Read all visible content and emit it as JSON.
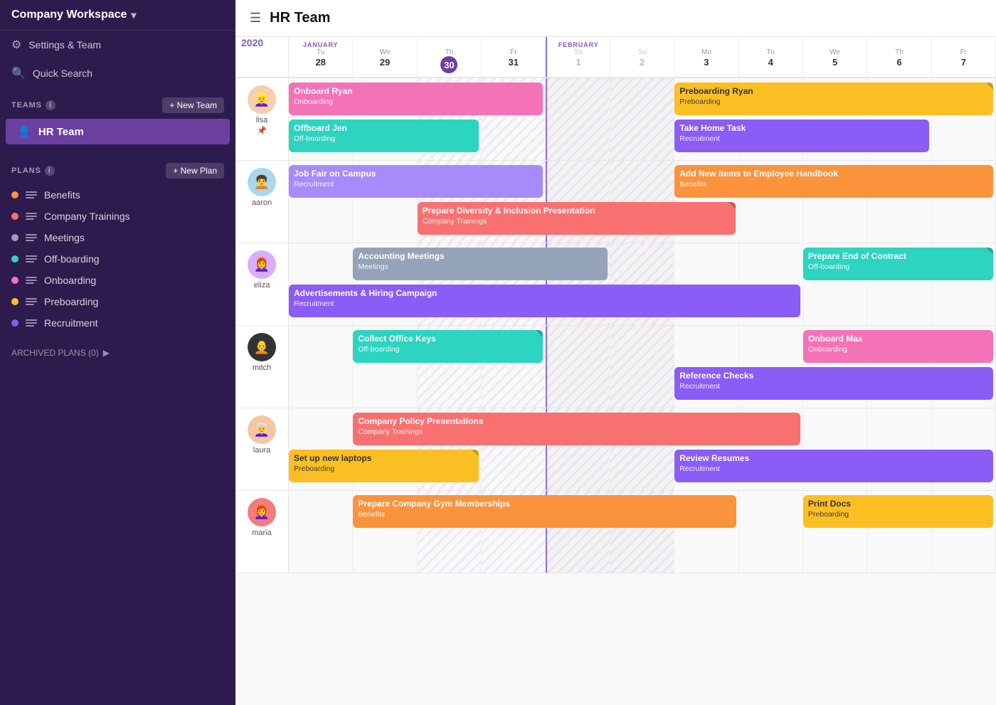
{
  "sidebar": {
    "workspace_name": "Company Workspace",
    "nav": [
      {
        "id": "settings",
        "label": "Settings & Team",
        "icon": "⚙"
      },
      {
        "id": "search",
        "label": "Quick Search",
        "icon": "🔍"
      }
    ],
    "teams_section": "TEAMS",
    "new_team_label": "+ New Team",
    "active_team": "HR Team",
    "plans_section": "PLANS",
    "new_plan_label": "+ New Plan",
    "plans": [
      {
        "id": "benefits",
        "label": "Benefits",
        "color": "#fb923c"
      },
      {
        "id": "company-trainings",
        "label": "Company Trainings",
        "color": "#f87171"
      },
      {
        "id": "meetings",
        "label": "Meetings",
        "color": "#94a3b8"
      },
      {
        "id": "off-boarding",
        "label": "Off-boarding",
        "color": "#2dd4bf"
      },
      {
        "id": "onboarding",
        "label": "Onboarding",
        "color": "#f472b6"
      },
      {
        "id": "preboarding",
        "label": "Preboarding",
        "color": "#fbbf24"
      },
      {
        "id": "recruitment",
        "label": "Recruitment",
        "color": "#8b5cf6"
      }
    ],
    "archived_label": "ARCHIVED PLANS (0)"
  },
  "header": {
    "title": "HR Team"
  },
  "calendar": {
    "year": "2020",
    "days": [
      {
        "name": "Tu",
        "num": "28",
        "month": "JANUARY",
        "weekend": false,
        "today": false,
        "hatched": false
      },
      {
        "name": "We",
        "num": "29",
        "month": "",
        "weekend": false,
        "today": false,
        "hatched": false
      },
      {
        "name": "Th",
        "num": "30",
        "month": "",
        "weekend": false,
        "today": true,
        "hatched": true
      },
      {
        "name": "Fr",
        "num": "31",
        "month": "",
        "weekend": false,
        "today": false,
        "hatched": true
      },
      {
        "name": "Sa",
        "num": "1",
        "month": "FEBRUARY",
        "weekend": true,
        "today": false,
        "hatched": true,
        "feb": true
      },
      {
        "name": "Su",
        "num": "2",
        "month": "",
        "weekend": true,
        "today": false,
        "hatched": true
      },
      {
        "name": "Mo",
        "num": "3",
        "month": "",
        "weekend": false,
        "today": false,
        "hatched": false
      },
      {
        "name": "Tu",
        "num": "4",
        "month": "",
        "weekend": false,
        "today": false,
        "hatched": false
      },
      {
        "name": "We",
        "num": "5",
        "month": "",
        "weekend": false,
        "today": false,
        "hatched": false
      },
      {
        "name": "Th",
        "num": "6",
        "month": "",
        "weekend": false,
        "today": false,
        "hatched": false
      },
      {
        "name": "Fr",
        "num": "7",
        "month": "",
        "weekend": false,
        "today": false,
        "hatched": false
      }
    ],
    "rows": [
      {
        "person": {
          "name": "lisa",
          "avatar_color": "#f5d0a9",
          "avatar_emoji": "👩",
          "pin": true
        },
        "tasks": [
          {
            "name": "Onboard Ryan",
            "plan": "Onboarding",
            "color": "t-pink",
            "col_start": 1,
            "col_span": 4,
            "row": 1
          },
          {
            "name": "Preboarding Ryan",
            "plan": "Preboarding",
            "color": "t-yellow",
            "col_start": 7,
            "col_span": 5,
            "row": 1,
            "corner": true
          },
          {
            "name": "Offboard Jen",
            "plan": "Off-boarding",
            "color": "t-teal",
            "col_start": 1,
            "col_span": 3,
            "row": 2
          },
          {
            "name": "Take Home Task",
            "plan": "Recruitment",
            "color": "t-purple",
            "col_start": 7,
            "col_span": 4,
            "row": 2
          }
        ]
      },
      {
        "person": {
          "name": "aaron",
          "avatar_color": "#a8d8ea",
          "avatar_emoji": "🧑",
          "pin": false
        },
        "tasks": [
          {
            "name": "Job Fair on Campus",
            "plan": "Recruitment",
            "color": "t-light-purple",
            "col_start": 1,
            "col_span": 4,
            "row": 1
          },
          {
            "name": "Add New Items to Employee Handbook",
            "plan": "Benefits",
            "color": "t-orange",
            "col_start": 7,
            "col_span": 5,
            "row": 1
          },
          {
            "name": "Prepare Diversity & Inclusion Presentation",
            "plan": "Company Trainings",
            "color": "t-red",
            "col_start": 3,
            "col_span": 5,
            "row": 2,
            "corner": true
          }
        ]
      },
      {
        "person": {
          "name": "eliza",
          "avatar_color": "#d7aefb",
          "avatar_emoji": "👩",
          "pin": false
        },
        "tasks": [
          {
            "name": "Accounting Meetings",
            "plan": "Meetings",
            "color": "t-blue-gray",
            "col_start": 2,
            "col_span": 4,
            "row": 1
          },
          {
            "name": "Prepare End of Contract",
            "plan": "Off-boarding",
            "color": "t-teal",
            "col_start": 9,
            "col_span": 3,
            "row": 1,
            "corner": true
          },
          {
            "name": "Advertisements & Hiring Campaign",
            "plan": "Recruitment",
            "color": "t-purple",
            "col_start": 1,
            "col_span": 8,
            "row": 2
          }
        ]
      },
      {
        "person": {
          "name": "mitch",
          "avatar_color": "#2d2d2d",
          "avatar_emoji": "🧑",
          "pin": false
        },
        "tasks": [
          {
            "name": "Collect Office Keys",
            "plan": "Off-boarding",
            "color": "t-teal",
            "col_start": 2,
            "col_span": 3,
            "row": 1,
            "corner": true
          },
          {
            "name": "Onboard Max",
            "plan": "Onboarding",
            "color": "t-pink",
            "col_start": 9,
            "col_span": 3,
            "row": 1
          },
          {
            "name": "Reference Checks",
            "plan": "Recruitment",
            "color": "t-purple",
            "col_start": 7,
            "col_span": 5,
            "row": 2
          }
        ]
      },
      {
        "person": {
          "name": "laura",
          "avatar_color": "#f5a623",
          "avatar_emoji": "👩",
          "pin": false
        },
        "tasks": [
          {
            "name": "Company Policy Presentations",
            "plan": "Company Trainings",
            "color": "t-red",
            "col_start": 2,
            "col_span": 7,
            "row": 1
          },
          {
            "name": "Set up new laptops",
            "plan": "Preboarding",
            "color": "t-yellow",
            "col_start": 1,
            "col_span": 3,
            "row": 2,
            "corner": true
          },
          {
            "name": "Review Resumes",
            "plan": "Recruitment",
            "color": "t-purple",
            "col_start": 7,
            "col_span": 5,
            "row": 2
          }
        ]
      },
      {
        "person": {
          "name": "maria",
          "avatar_color": "#f47c7c",
          "avatar_emoji": "👩",
          "pin": false
        },
        "tasks": [
          {
            "name": "Prepare Company Gym Memberships",
            "plan": "Benefits",
            "color": "t-orange",
            "col_start": 2,
            "col_span": 6,
            "row": 1
          },
          {
            "name": "Print Docs",
            "plan": "Preboarding",
            "color": "t-yellow",
            "col_start": 9,
            "col_span": 3,
            "row": 1
          }
        ]
      }
    ]
  }
}
